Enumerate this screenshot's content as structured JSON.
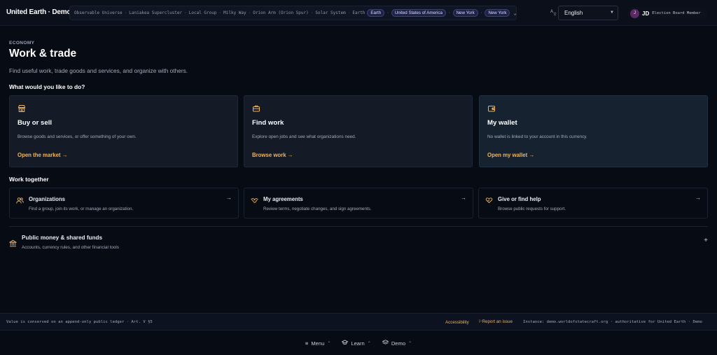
{
  "header": {
    "app_title": "United Earth · Demo",
    "breadcrumbs": [
      "Observable Universe",
      "Laniakea Supercluster",
      "Local Group",
      "Milky Way",
      "Orion Arm (Orion Spur)",
      "Solar System",
      "Earth"
    ],
    "breadcrumb_pills": [
      "Earth",
      "United States of America",
      "New York",
      "New York"
    ],
    "language": "English",
    "user": {
      "avatar_letter": "J",
      "initials": "JD",
      "role": "Election Board Member"
    }
  },
  "main": {
    "eyebrow": "ECONOMY",
    "title": "Work & trade",
    "subtitle": "Find useful work, trade goods and services, and organize with others.",
    "question": "What would you like to do?",
    "cards": [
      {
        "title": "Buy or sell",
        "desc": "Browse goods and services, or offer something of your own.",
        "link": "Open the market →",
        "icon": "storefront-icon"
      },
      {
        "title": "Find work",
        "desc": "Explore open jobs and see what organizations need.",
        "link": "Browse work →",
        "icon": "briefcase-icon"
      },
      {
        "title": "My wallet",
        "desc": "No wallet is linked to your account in this currency.",
        "link": "Open my wallet →",
        "icon": "wallet-icon"
      }
    ],
    "together_heading": "Work together",
    "together": [
      {
        "title": "Organizations",
        "desc": "Find a group, join its work, or manage an organization.",
        "icon": "people-icon"
      },
      {
        "title": "My agreements",
        "desc": "Review terms, negotiate changes, and sign agreements.",
        "icon": "handshake-icon"
      },
      {
        "title": "Give or find help",
        "desc": "Browse public requests for support.",
        "icon": "heart-hand-icon"
      }
    ],
    "funds": {
      "title": "Public money & shared funds",
      "desc": "Accounts, currency rules, and other financial tools",
      "icon": "bank-icon"
    }
  },
  "footer": {
    "left": "Value is conserved on an append-only public ledger · Art. V §5",
    "accessibility": "Accessibility",
    "report": "Report an issue",
    "instance": "Instance: demo.worldofstatecraft.org · authoritative for United Earth · Demo"
  },
  "bottom_nav": [
    {
      "label": "Menu",
      "icon": "menu-icon"
    },
    {
      "label": "Learn",
      "icon": "graduation-cap-icon"
    },
    {
      "label": "Demo",
      "icon": "stack-icon"
    }
  ],
  "colors": {
    "accent": "#f0b45a",
    "background": "#070b14",
    "card": "#141b27",
    "pill": "#1e2247"
  }
}
